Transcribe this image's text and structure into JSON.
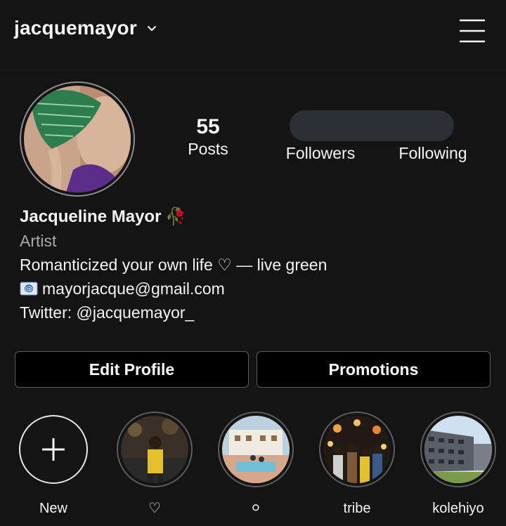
{
  "header": {
    "username": "jacquemayor",
    "switch_icon": "chevron-down-icon",
    "menu_icon": "hamburger-menu-icon"
  },
  "stats": {
    "posts_count": "55",
    "posts_label": "Posts",
    "followers_label": "Followers",
    "following_label": "Following"
  },
  "bio": {
    "name": "Jacqueline Mayor",
    "name_emoji": "🥀",
    "category": "Artist",
    "line1": "Romanticized your own life ♡ — live green",
    "email": "mayorjacque@gmail.com",
    "email_icon": "email-icon",
    "twitter": "Twitter: @jacquemayor_"
  },
  "actions": {
    "edit_label": "Edit Profile",
    "promotions_label": "Promotions"
  },
  "highlights": [
    {
      "label": "New",
      "icon": "plus-icon"
    },
    {
      "label": "♡"
    },
    {
      "label": "⚪"
    },
    {
      "label": "tribe"
    },
    {
      "label": "kolehiyo"
    }
  ],
  "colors": {
    "background": "#141414",
    "button_bg": "#000000",
    "ring": "#5c5c5c",
    "secondary_text": "#a8a8a8"
  }
}
